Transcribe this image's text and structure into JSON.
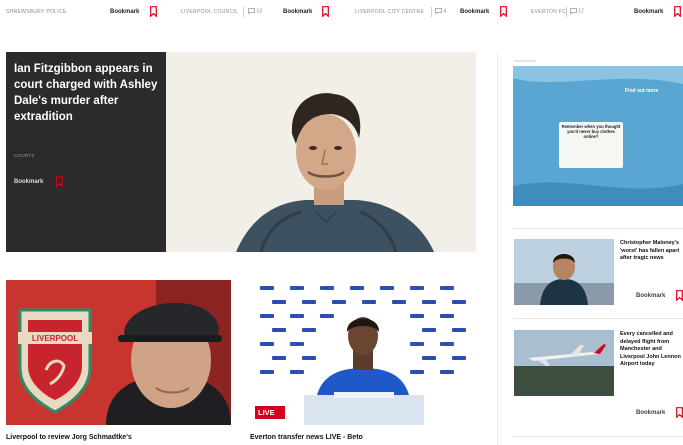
{
  "topbar": {
    "items": [
      {
        "category": "SHREWSBURY POLICE",
        "comments": "",
        "bookmark": "Bookmark"
      },
      {
        "category": "LIVERPOOL COUNCIL",
        "comments": "13",
        "bookmark": "Bookmark"
      },
      {
        "category": "LIVERPOOL CITY CENTRE",
        "comments": "4",
        "bookmark": "Bookmark"
      },
      {
        "category": "EVERTON FC",
        "comments": "17",
        "bookmark": "Bookmark"
      }
    ]
  },
  "hero": {
    "title": "Ian Fitzgibbon appears in court charged with Ashley Dale's murder after extradition",
    "tag": "COURTS",
    "bookmark": "Bookmark"
  },
  "cards": [
    {
      "title": "Liverpool to review Jorg Schmadtke's"
    },
    {
      "title": "Everton transfer news LIVE - Beto",
      "live_label": "LIVE"
    }
  ],
  "sidebar": {
    "ad": {
      "label": "Advertisement",
      "corner_text": "Find out more",
      "tag_text": "Remember when you thought you'd never buy clothes online?"
    },
    "stories": [
      {
        "title": "Christopher Maloney's 'worst' has fallen apart after tragic news",
        "bookmark": "Bookmark"
      },
      {
        "title": "Every cancelled and delayed flight from Manchester and Liverpool John Lennon Airport today",
        "bookmark": "Bookmark"
      }
    ]
  },
  "colors": {
    "accent_red": "#d6001c",
    "hero_panel": "#2b2b2b"
  }
}
